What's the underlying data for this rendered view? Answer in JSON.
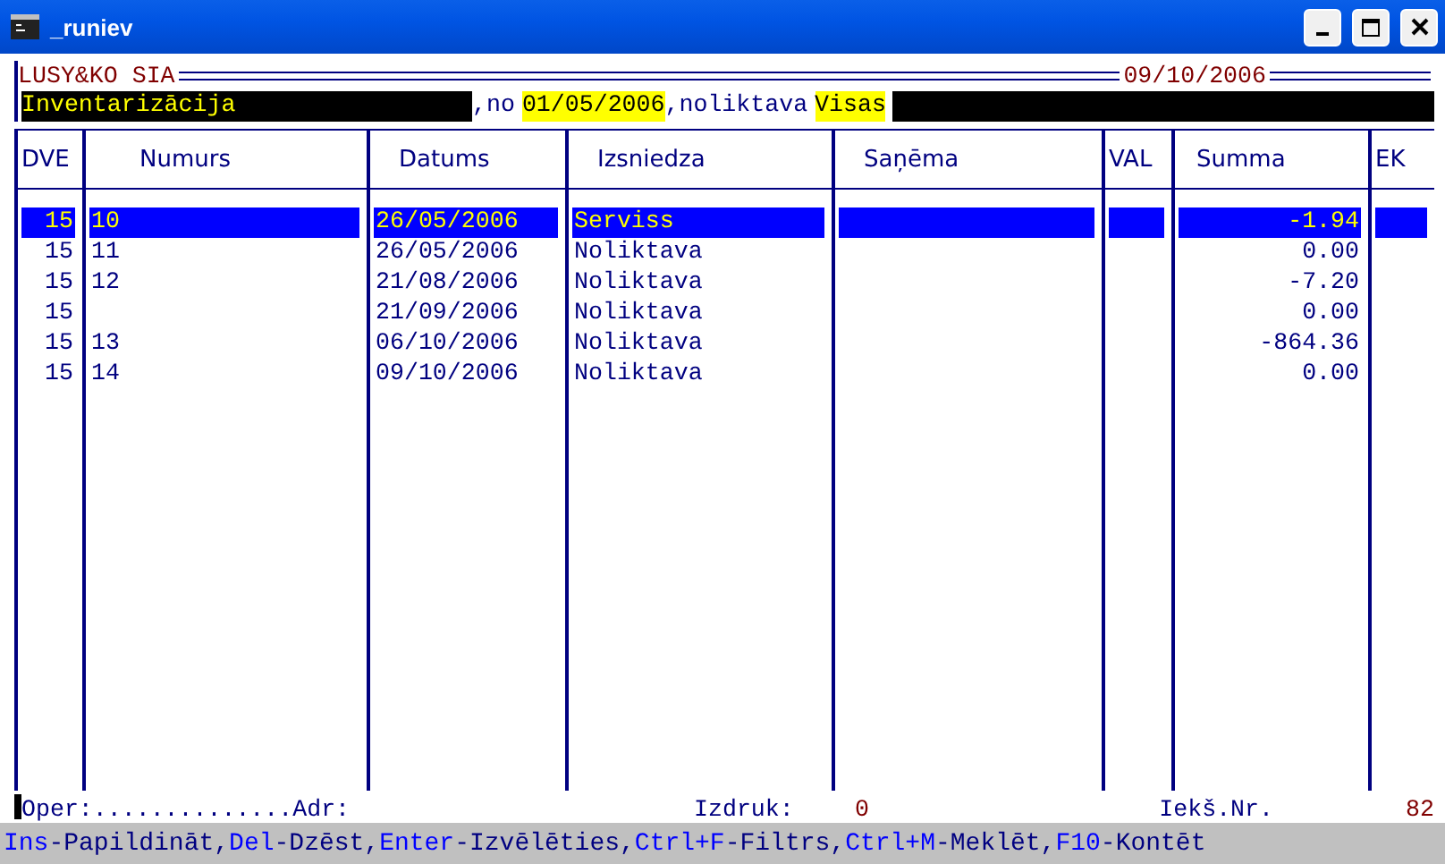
{
  "window": {
    "title": "_runiev"
  },
  "company": "LUSY&KO SIA",
  "date": "09/10/2006",
  "filter": {
    "doc_type": "Inventarizācija",
    "from_label": ",no",
    "from_date": "01/05/2006",
    "warehouse_label": ",noliktava",
    "warehouse": "Visas"
  },
  "table": {
    "columns": [
      "DVE",
      "Numurs",
      "Datums",
      "Izsniedza",
      "Saņēma",
      "VAL",
      "Summa",
      "EK"
    ],
    "rows": [
      {
        "dve": "15",
        "numurs": "10",
        "datums": "26/05/2006",
        "izsniedza": "Serviss",
        "summa": "-1.94",
        "selected": true
      },
      {
        "dve": "15",
        "numurs": "11",
        "datums": "26/05/2006",
        "izsniedza": "Noliktava",
        "summa": "0.00",
        "selected": false
      },
      {
        "dve": "15",
        "numurs": "12",
        "datums": "21/08/2006",
        "izsniedza": "Noliktava",
        "summa": "-7.20",
        "selected": false
      },
      {
        "dve": "15",
        "datums": "21/09/2006",
        "izsniedza": "Noliktava",
        "summa": "0.00",
        "selected": false
      },
      {
        "dve": "15",
        "numurs": "13",
        "datums": "06/10/2006",
        "izsniedza": "Noliktava",
        "summa": "-864.36",
        "selected": false
      },
      {
        "dve": "15",
        "numurs": "14",
        "datums": "09/10/2006",
        "izsniedza": "Noliktava",
        "summa": "0.00",
        "selected": false
      }
    ]
  },
  "status": {
    "oper": "Oper:..............Adr:",
    "print_label": "Izdruk:",
    "print_value": "0",
    "nr_label": "Iekš.Nr.",
    "nr_value": "82"
  },
  "hints": [
    {
      "key": "Ins",
      "action": "-Papildināt,"
    },
    {
      "key": "Del",
      "action": "-Dzēst,"
    },
    {
      "key": "Enter",
      "action": "-Izvēlēties,"
    },
    {
      "key": "Ctrl+F",
      "action": "-Filtrs,"
    },
    {
      "key": "Ctrl+M",
      "action": "-Meklēt,"
    },
    {
      "key": "F10",
      "action": "-Kontēt"
    }
  ]
}
